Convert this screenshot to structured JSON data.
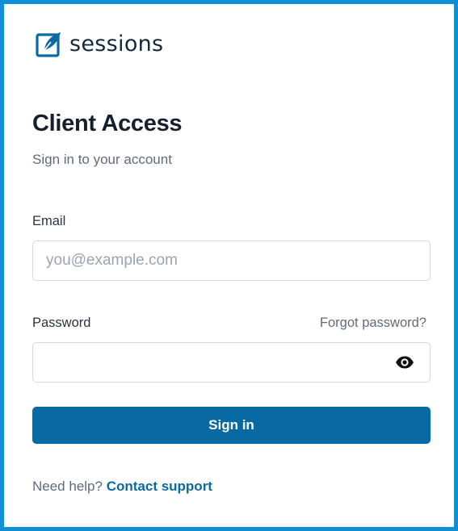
{
  "brand": {
    "name": "sessions",
    "logo_icon": "feather-checkbox-icon",
    "logo_color": "#0b6aa2"
  },
  "header": {
    "title": "Client Access",
    "subtitle": "Sign in to your account"
  },
  "form": {
    "email": {
      "label": "Email",
      "placeholder": "you@example.com",
      "value": ""
    },
    "password": {
      "label": "Password",
      "value": "",
      "toggle_icon": "eye-icon"
    },
    "forgot_label": "Forgot password?",
    "submit_label": "Sign in"
  },
  "footer": {
    "help_text": "Need help?",
    "support_link": "Contact support"
  },
  "colors": {
    "border_frame": "#0f8fd6",
    "primary_button": "#0969a3",
    "link": "#0b6aa2",
    "muted_text": "#5f6b7a",
    "heading": "#161f2e"
  }
}
